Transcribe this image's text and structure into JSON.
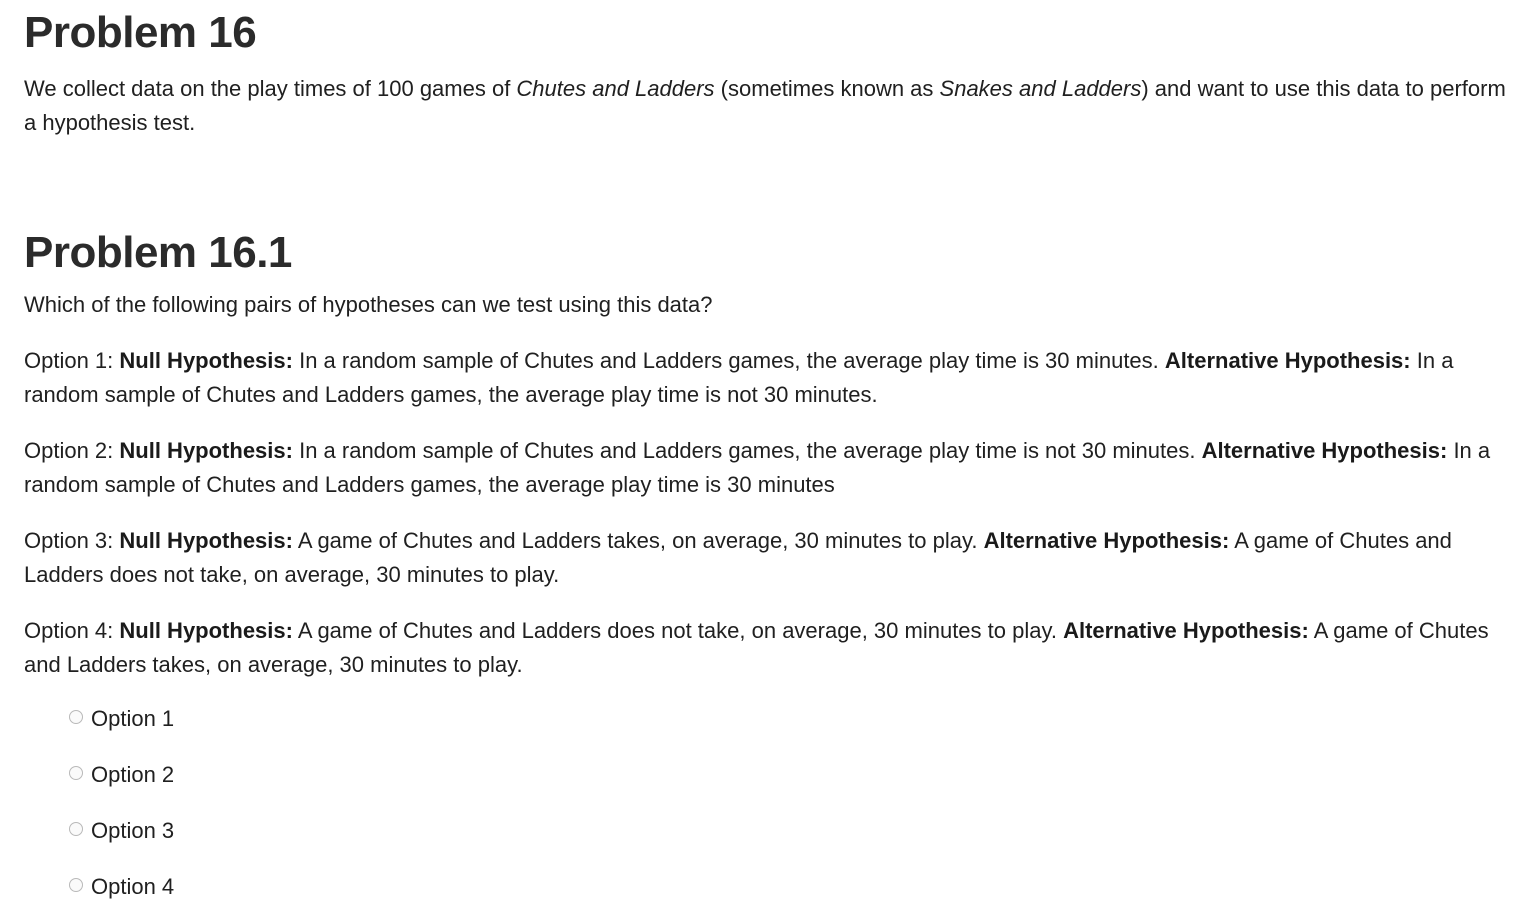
{
  "problem": {
    "title": "Problem 16",
    "intro": {
      "part1": "We collect data on the play times of 100 games of ",
      "title1": "Chutes and Ladders",
      "part2": " (sometimes known as ",
      "title2": "Snakes and Ladders",
      "part3": ") and want to use this data to perform a hypothesis test."
    }
  },
  "subproblem": {
    "title": "Problem 16.1",
    "question": "Which of the following pairs of hypotheses can we test using this data?",
    "options": [
      {
        "prefix": "Option 1: ",
        "null_label": "Null Hypothesis:",
        "null_text": " In a random sample of Chutes and Ladders games, the average play time is 30 minutes. ",
        "alt_label": "Alternative Hypothesis:",
        "alt_text": " In a random sample of Chutes and Ladders games, the average play time is not 30 minutes."
      },
      {
        "prefix": "Option 2: ",
        "null_label": "Null Hypothesis:",
        "null_text": " In a random sample of Chutes and Ladders games, the average play time is not 30 minutes. ",
        "alt_label": "Alternative Hypothesis:",
        "alt_text": " In a random sample of Chutes and Ladders games, the average play time is 30 minutes"
      },
      {
        "prefix": "Option 3: ",
        "null_label": "Null Hypothesis:",
        "null_text": " A game of Chutes and Ladders takes, on average, 30 minutes to play. ",
        "alt_label": "Alternative Hypothesis:",
        "alt_text": " A game of Chutes and Ladders does not take, on average, 30 minutes to play."
      },
      {
        "prefix": "Option 4: ",
        "null_label": "Null Hypothesis:",
        "null_text": " A game of Chutes and Ladders does not take, on average, 30 minutes to play. ",
        "alt_label": "Alternative Hypothesis:",
        "alt_text": " A game of Chutes and Ladders takes, on average, 30 minutes to play."
      }
    ],
    "choices": [
      {
        "label": "Option 1",
        "selected": false
      },
      {
        "label": "Option 2",
        "selected": false
      },
      {
        "label": "Option 3",
        "selected": false
      },
      {
        "label": "Option 4",
        "selected": false
      }
    ]
  },
  "colors": {
    "text": "#202020",
    "heading": "#2b2b2b",
    "radio_border": "#b9b9b9"
  }
}
